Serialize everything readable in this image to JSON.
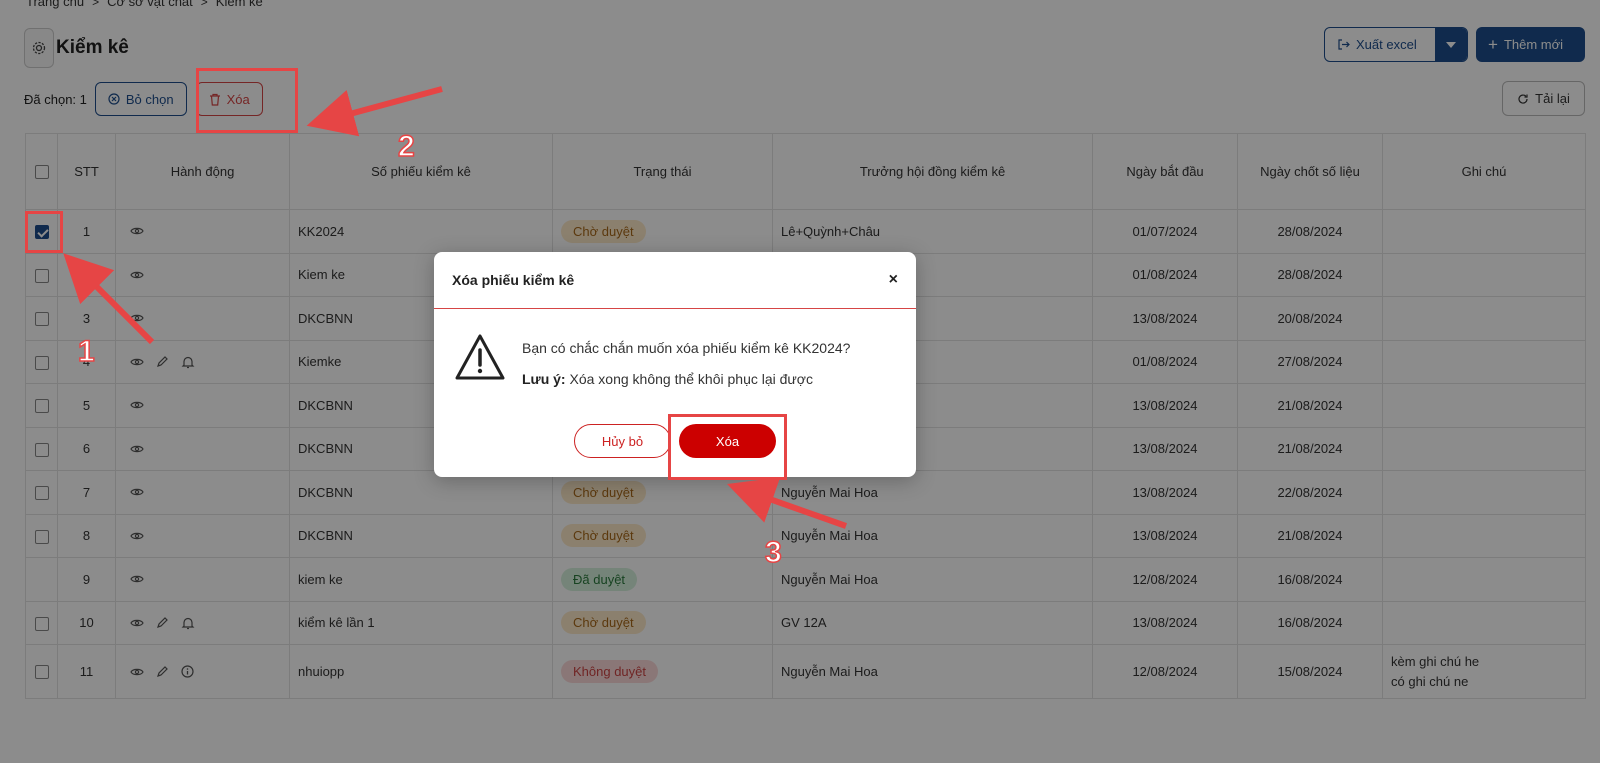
{
  "breadcrumb": [
    "Trang chủ",
    "Cơ sở vật chất",
    "Kiểm kê"
  ],
  "page_title": "Kiểm kê",
  "toolbar": {
    "export_label": "Xuất excel",
    "add_label": "Thêm mới",
    "reload_label": "Tải lại"
  },
  "selection": {
    "selected_label": "Đã chọn: 1",
    "unselect_label": "Bỏ chọn",
    "delete_label": "Xóa"
  },
  "table": {
    "headers": {
      "stt": "STT",
      "actions": "Hành động",
      "code": "Số phiếu kiểm kê",
      "status": "Trạng thái",
      "head": "Trưởng hội đồng kiểm kê",
      "start": "Ngày bắt đầu",
      "end": "Ngày chốt số liệu",
      "note": "Ghi chú"
    },
    "rows": [
      {
        "stt": "1",
        "code": "KK2024",
        "status": "Chờ duyệt",
        "head": "Lê+Quỳnh+Châu",
        "start": "01/07/2024",
        "end": "28/08/2024",
        "note": "",
        "note2": ""
      },
      {
        "stt": "2",
        "code": "Kiem ke",
        "status": "",
        "head": "",
        "start": "01/08/2024",
        "end": "28/08/2024",
        "note": "",
        "note2": ""
      },
      {
        "stt": "3",
        "code": "DKCBNN",
        "status": "",
        "head": "",
        "start": "13/08/2024",
        "end": "20/08/2024",
        "note": "",
        "note2": ""
      },
      {
        "stt": "4",
        "code": "Kiemke",
        "status": "",
        "head": "",
        "start": "01/08/2024",
        "end": "27/08/2024",
        "note": "",
        "note2": ""
      },
      {
        "stt": "5",
        "code": "DKCBNN",
        "status": "",
        "head": "",
        "start": "13/08/2024",
        "end": "21/08/2024",
        "note": "",
        "note2": ""
      },
      {
        "stt": "6",
        "code": "DKCBNN",
        "status": "",
        "head": "",
        "start": "13/08/2024",
        "end": "21/08/2024",
        "note": "",
        "note2": ""
      },
      {
        "stt": "7",
        "code": "DKCBNN",
        "status": "Chờ duyệt",
        "head": "Nguyễn Mai Hoa",
        "start": "13/08/2024",
        "end": "22/08/2024",
        "note": "",
        "note2": ""
      },
      {
        "stt": "8",
        "code": "DKCBNN",
        "status": "Chờ duyệt",
        "head": "Nguyễn Mai Hoa",
        "start": "13/08/2024",
        "end": "21/08/2024",
        "note": "",
        "note2": ""
      },
      {
        "stt": "9",
        "code": "kiem ke",
        "status": "Đã duyệt",
        "head": "Nguyễn Mai Hoa",
        "start": "12/08/2024",
        "end": "16/08/2024",
        "note": "",
        "note2": ""
      },
      {
        "stt": "10",
        "code": "kiểm kê lần 1",
        "status": "Chờ duyệt",
        "head": "GV 12A",
        "start": "13/08/2024",
        "end": "16/08/2024",
        "note": "",
        "note2": ""
      },
      {
        "stt": "11",
        "code": "nhuiopp",
        "status": "Không duyệt",
        "head": "Nguyễn Mai Hoa",
        "start": "12/08/2024",
        "end": "15/08/2024",
        "note": "kèm ghi chú he",
        "note2": "có ghi chú ne"
      }
    ]
  },
  "modal": {
    "title": "Xóa phiếu kiểm kê",
    "close": "×",
    "message": "Bạn có chắc chắn muốn xóa phiếu kiểm kê KK2024?",
    "note_label": "Lưu ý:",
    "note_text": "Xóa xong không thể khôi phục lại được",
    "cancel_label": "Hủy bỏ",
    "confirm_label": "Xóa"
  },
  "annotations": {
    "n1": "1",
    "n2": "2",
    "n3": "3"
  },
  "colors": {
    "primary": "#1e4e8c",
    "danger": "#cc0000",
    "annotation": "#e64545"
  }
}
